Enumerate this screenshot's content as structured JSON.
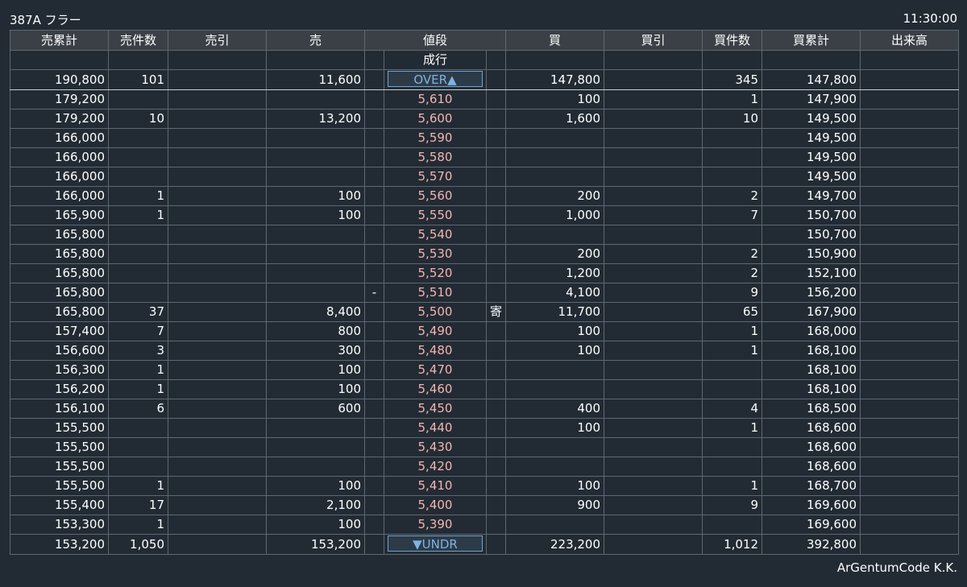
{
  "header": {
    "title": "387A フラー",
    "time": "11:30:00"
  },
  "footer": {
    "company": "ArGentumCode K.K."
  },
  "columns": [
    "売累計",
    "売件数",
    "売引",
    "売",
    "",
    "値段",
    "",
    "買",
    "買引",
    "買件数",
    "買累計",
    "出来高"
  ],
  "rows": [
    {
      "sell_cum": "",
      "sell_count": "",
      "sell_hikiri": "",
      "sell": "",
      "sell_mark": "",
      "price": "成行",
      "buy_mark": "",
      "buy": "",
      "buy_hikiri": "",
      "buy_count": "",
      "buy_cum": "",
      "volume": ""
    },
    {
      "sell_cum": "190,800",
      "sell_count": "101",
      "sell_hikiri": "",
      "sell": "11,600",
      "sell_mark": "",
      "price": "OVER▲",
      "buy_mark": "",
      "buy": "147,800",
      "buy_hikiri": "",
      "buy_count": "345",
      "buy_cum": "147,800",
      "volume": ""
    },
    {
      "sell_cum": "179,200",
      "sell_count": "",
      "sell_hikiri": "",
      "sell": "",
      "sell_mark": "",
      "price": "5,610",
      "buy_mark": "",
      "buy": "100",
      "buy_hikiri": "",
      "buy_count": "1",
      "buy_cum": "147,900",
      "volume": ""
    },
    {
      "sell_cum": "179,200",
      "sell_count": "10",
      "sell_hikiri": "",
      "sell": "13,200",
      "sell_mark": "",
      "price": "5,600",
      "buy_mark": "",
      "buy": "1,600",
      "buy_hikiri": "",
      "buy_count": "10",
      "buy_cum": "149,500",
      "volume": ""
    },
    {
      "sell_cum": "166,000",
      "sell_count": "",
      "sell_hikiri": "",
      "sell": "",
      "sell_mark": "",
      "price": "5,590",
      "buy_mark": "",
      "buy": "",
      "buy_hikiri": "",
      "buy_count": "",
      "buy_cum": "149,500",
      "volume": ""
    },
    {
      "sell_cum": "166,000",
      "sell_count": "",
      "sell_hikiri": "",
      "sell": "",
      "sell_mark": "",
      "price": "5,580",
      "buy_mark": "",
      "buy": "",
      "buy_hikiri": "",
      "buy_count": "",
      "buy_cum": "149,500",
      "volume": ""
    },
    {
      "sell_cum": "166,000",
      "sell_count": "",
      "sell_hikiri": "",
      "sell": "",
      "sell_mark": "",
      "price": "5,570",
      "buy_mark": "",
      "buy": "",
      "buy_hikiri": "",
      "buy_count": "",
      "buy_cum": "149,500",
      "volume": ""
    },
    {
      "sell_cum": "166,000",
      "sell_count": "1",
      "sell_hikiri": "",
      "sell": "100",
      "sell_mark": "",
      "price": "5,560",
      "buy_mark": "",
      "buy": "200",
      "buy_hikiri": "",
      "buy_count": "2",
      "buy_cum": "149,700",
      "volume": ""
    },
    {
      "sell_cum": "165,900",
      "sell_count": "1",
      "sell_hikiri": "",
      "sell": "100",
      "sell_mark": "",
      "price": "5,550",
      "buy_mark": "",
      "buy": "1,000",
      "buy_hikiri": "",
      "buy_count": "7",
      "buy_cum": "150,700",
      "volume": ""
    },
    {
      "sell_cum": "165,800",
      "sell_count": "",
      "sell_hikiri": "",
      "sell": "",
      "sell_mark": "",
      "price": "5,540",
      "buy_mark": "",
      "buy": "",
      "buy_hikiri": "",
      "buy_count": "",
      "buy_cum": "150,700",
      "volume": ""
    },
    {
      "sell_cum": "165,800",
      "sell_count": "",
      "sell_hikiri": "",
      "sell": "",
      "sell_mark": "",
      "price": "5,530",
      "buy_mark": "",
      "buy": "200",
      "buy_hikiri": "",
      "buy_count": "2",
      "buy_cum": "150,900",
      "volume": ""
    },
    {
      "sell_cum": "165,800",
      "sell_count": "",
      "sell_hikiri": "",
      "sell": "",
      "sell_mark": "",
      "price": "5,520",
      "buy_mark": "",
      "buy": "1,200",
      "buy_hikiri": "",
      "buy_count": "2",
      "buy_cum": "152,100",
      "volume": ""
    },
    {
      "sell_cum": "165,800",
      "sell_count": "",
      "sell_hikiri": "",
      "sell": "",
      "sell_mark": "-",
      "price": "5,510",
      "buy_mark": "",
      "buy": "4,100",
      "buy_hikiri": "",
      "buy_count": "9",
      "buy_cum": "156,200",
      "volume": ""
    },
    {
      "sell_cum": "165,800",
      "sell_count": "37",
      "sell_hikiri": "",
      "sell": "8,400",
      "sell_mark": "",
      "price": "5,500",
      "buy_mark": "寄",
      "buy": "11,700",
      "buy_hikiri": "",
      "buy_count": "65",
      "buy_cum": "167,900",
      "volume": ""
    },
    {
      "sell_cum": "157,400",
      "sell_count": "7",
      "sell_hikiri": "",
      "sell": "800",
      "sell_mark": "",
      "price": "5,490",
      "buy_mark": "",
      "buy": "100",
      "buy_hikiri": "",
      "buy_count": "1",
      "buy_cum": "168,000",
      "volume": ""
    },
    {
      "sell_cum": "156,600",
      "sell_count": "3",
      "sell_hikiri": "",
      "sell": "300",
      "sell_mark": "",
      "price": "5,480",
      "buy_mark": "",
      "buy": "100",
      "buy_hikiri": "",
      "buy_count": "1",
      "buy_cum": "168,100",
      "volume": ""
    },
    {
      "sell_cum": "156,300",
      "sell_count": "1",
      "sell_hikiri": "",
      "sell": "100",
      "sell_mark": "",
      "price": "5,470",
      "buy_mark": "",
      "buy": "",
      "buy_hikiri": "",
      "buy_count": "",
      "buy_cum": "168,100",
      "volume": ""
    },
    {
      "sell_cum": "156,200",
      "sell_count": "1",
      "sell_hikiri": "",
      "sell": "100",
      "sell_mark": "",
      "price": "5,460",
      "buy_mark": "",
      "buy": "",
      "buy_hikiri": "",
      "buy_count": "",
      "buy_cum": "168,100",
      "volume": ""
    },
    {
      "sell_cum": "156,100",
      "sell_count": "6",
      "sell_hikiri": "",
      "sell": "600",
      "sell_mark": "",
      "price": "5,450",
      "buy_mark": "",
      "buy": "400",
      "buy_hikiri": "",
      "buy_count": "4",
      "buy_cum": "168,500",
      "volume": ""
    },
    {
      "sell_cum": "155,500",
      "sell_count": "",
      "sell_hikiri": "",
      "sell": "",
      "sell_mark": "",
      "price": "5,440",
      "buy_mark": "",
      "buy": "100",
      "buy_hikiri": "",
      "buy_count": "1",
      "buy_cum": "168,600",
      "volume": ""
    },
    {
      "sell_cum": "155,500",
      "sell_count": "",
      "sell_hikiri": "",
      "sell": "",
      "sell_mark": "",
      "price": "5,430",
      "buy_mark": "",
      "buy": "",
      "buy_hikiri": "",
      "buy_count": "",
      "buy_cum": "168,600",
      "volume": ""
    },
    {
      "sell_cum": "155,500",
      "sell_count": "",
      "sell_hikiri": "",
      "sell": "",
      "sell_mark": "",
      "price": "5,420",
      "buy_mark": "",
      "buy": "",
      "buy_hikiri": "",
      "buy_count": "",
      "buy_cum": "168,600",
      "volume": ""
    },
    {
      "sell_cum": "155,500",
      "sell_count": "1",
      "sell_hikiri": "",
      "sell": "100",
      "sell_mark": "",
      "price": "5,410",
      "buy_mark": "",
      "buy": "100",
      "buy_hikiri": "",
      "buy_count": "1",
      "buy_cum": "168,700",
      "volume": ""
    },
    {
      "sell_cum": "155,400",
      "sell_count": "17",
      "sell_hikiri": "",
      "sell": "2,100",
      "sell_mark": "",
      "price": "5,400",
      "buy_mark": "",
      "buy": "900",
      "buy_hikiri": "",
      "buy_count": "9",
      "buy_cum": "169,600",
      "volume": ""
    },
    {
      "sell_cum": "153,300",
      "sell_count": "1",
      "sell_hikiri": "",
      "sell": "100",
      "sell_mark": "",
      "price": "5,390",
      "buy_mark": "",
      "buy": "",
      "buy_hikiri": "",
      "buy_count": "",
      "buy_cum": "169,600",
      "volume": ""
    },
    {
      "sell_cum": "153,200",
      "sell_count": "1,050",
      "sell_hikiri": "",
      "sell": "153,200",
      "sell_mark": "",
      "price": "▼UNDR",
      "buy_mark": "",
      "buy": "223,200",
      "buy_hikiri": "",
      "buy_count": "1,012",
      "buy_cum": "392,800",
      "volume": ""
    }
  ],
  "colors": {
    "background": "#222b33",
    "header_bg": "#3b4046",
    "grid": "#5f6870",
    "price_text": "#f4b4b4",
    "flag_text": "#7db3e0",
    "flag_border": "#6ea3d0"
  }
}
